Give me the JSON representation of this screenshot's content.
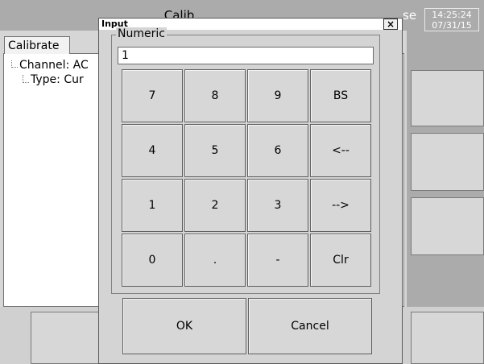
{
  "background_app": {
    "title_partial": "Calib",
    "close_text_partial": "se",
    "clock": {
      "time": "14:25:24",
      "date": "07/31/15"
    },
    "tab_label": "Calibrate",
    "tree": [
      {
        "label": "Channel: AC"
      },
      {
        "label": "Type: Cur"
      }
    ]
  },
  "dialog": {
    "title": "Input",
    "close_glyph": "×",
    "group_label": "Numeric",
    "input_value": "1",
    "keys": [
      [
        "7",
        "8",
        "9",
        "BS"
      ],
      [
        "4",
        "5",
        "6",
        "<--"
      ],
      [
        "1",
        "2",
        "3",
        "-->"
      ],
      [
        "0",
        ".",
        "-",
        "Clr"
      ]
    ],
    "ok_label": "OK",
    "cancel_label": "Cancel"
  },
  "colors": {
    "background": "#ababab",
    "dialog": "#d4d4d4",
    "button": "#d7d7d7"
  }
}
